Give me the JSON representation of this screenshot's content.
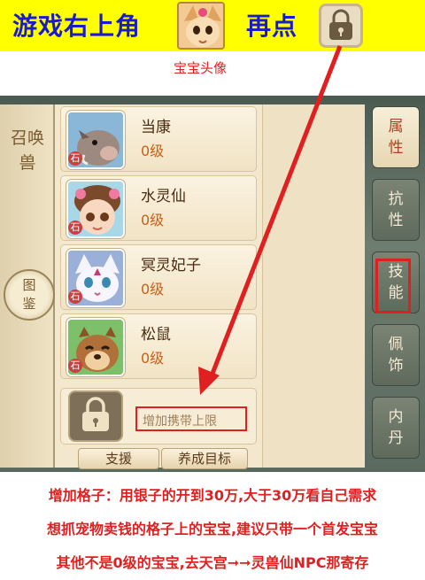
{
  "banner": {
    "text_1": "游戏右上角",
    "text_2": "再点",
    "avatar_caption": "宝宝头像",
    "background": "#ffff00",
    "text_color": "#1a1ad0"
  },
  "panel": {
    "summon_tab": "召唤兽",
    "atlas_button": "图鉴",
    "side_tabs": [
      "属性",
      "抗性",
      "技能",
      "佩饰",
      "内丹"
    ],
    "active_tab": "属性",
    "highlighted_tab": "技能",
    "pets": [
      {
        "name": "当康",
        "level": "0级",
        "icon": "boar-pet-avatar"
      },
      {
        "name": "水灵仙",
        "level": "0级",
        "icon": "fairy-pet-avatar"
      },
      {
        "name": "冥灵妃子",
        "level": "0级",
        "icon": "white-fox-pet-avatar"
      },
      {
        "name": "松鼠",
        "level": "0级",
        "icon": "squirrel-pet-avatar"
      }
    ],
    "pet_badge": "石",
    "expand_label": "增加携带上限",
    "support_button": "支援",
    "goal_button": "养成目标"
  },
  "notes": [
    "增加格子：用银子的开到30万,大于30万看自己需求",
    "想抓宠物卖钱的格子上的宝宝,建议只带一个首发宝宝",
    "其他不是0级的宝宝,去天宫➞➞灵兽仙NPC那寄存"
  ],
  "colors": {
    "highlight": "#e02020",
    "note_text": "#e02020"
  }
}
